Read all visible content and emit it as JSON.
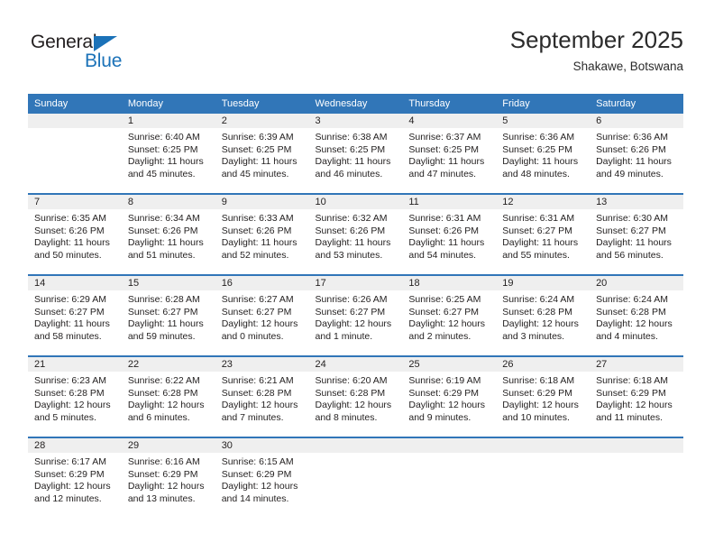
{
  "brand": {
    "name_dark": "General",
    "name_blue": "Blue",
    "accent_color": "#1b72b8"
  },
  "header": {
    "title": "September 2025",
    "subtitle": "Shakawe, Botswana"
  },
  "colors": {
    "header_blue": "#3176b8",
    "daynum_gray": "#efefef",
    "text": "#221f1f"
  },
  "weekday_headers": [
    "Sunday",
    "Monday",
    "Tuesday",
    "Wednesday",
    "Thursday",
    "Friday",
    "Saturday"
  ],
  "weeks": [
    [
      {
        "day": "",
        "sunrise": "",
        "sunset": "",
        "daylight": "",
        "blank": true
      },
      {
        "day": "1",
        "sunrise": "Sunrise: 6:40 AM",
        "sunset": "Sunset: 6:25 PM",
        "daylight": "Daylight: 11 hours and 45 minutes."
      },
      {
        "day": "2",
        "sunrise": "Sunrise: 6:39 AM",
        "sunset": "Sunset: 6:25 PM",
        "daylight": "Daylight: 11 hours and 45 minutes."
      },
      {
        "day": "3",
        "sunrise": "Sunrise: 6:38 AM",
        "sunset": "Sunset: 6:25 PM",
        "daylight": "Daylight: 11 hours and 46 minutes."
      },
      {
        "day": "4",
        "sunrise": "Sunrise: 6:37 AM",
        "sunset": "Sunset: 6:25 PM",
        "daylight": "Daylight: 11 hours and 47 minutes."
      },
      {
        "day": "5",
        "sunrise": "Sunrise: 6:36 AM",
        "sunset": "Sunset: 6:25 PM",
        "daylight": "Daylight: 11 hours and 48 minutes."
      },
      {
        "day": "6",
        "sunrise": "Sunrise: 6:36 AM",
        "sunset": "Sunset: 6:26 PM",
        "daylight": "Daylight: 11 hours and 49 minutes."
      }
    ],
    [
      {
        "day": "7",
        "sunrise": "Sunrise: 6:35 AM",
        "sunset": "Sunset: 6:26 PM",
        "daylight": "Daylight: 11 hours and 50 minutes."
      },
      {
        "day": "8",
        "sunrise": "Sunrise: 6:34 AM",
        "sunset": "Sunset: 6:26 PM",
        "daylight": "Daylight: 11 hours and 51 minutes."
      },
      {
        "day": "9",
        "sunrise": "Sunrise: 6:33 AM",
        "sunset": "Sunset: 6:26 PM",
        "daylight": "Daylight: 11 hours and 52 minutes."
      },
      {
        "day": "10",
        "sunrise": "Sunrise: 6:32 AM",
        "sunset": "Sunset: 6:26 PM",
        "daylight": "Daylight: 11 hours and 53 minutes."
      },
      {
        "day": "11",
        "sunrise": "Sunrise: 6:31 AM",
        "sunset": "Sunset: 6:26 PM",
        "daylight": "Daylight: 11 hours and 54 minutes."
      },
      {
        "day": "12",
        "sunrise": "Sunrise: 6:31 AM",
        "sunset": "Sunset: 6:27 PM",
        "daylight": "Daylight: 11 hours and 55 minutes."
      },
      {
        "day": "13",
        "sunrise": "Sunrise: 6:30 AM",
        "sunset": "Sunset: 6:27 PM",
        "daylight": "Daylight: 11 hours and 56 minutes."
      }
    ],
    [
      {
        "day": "14",
        "sunrise": "Sunrise: 6:29 AM",
        "sunset": "Sunset: 6:27 PM",
        "daylight": "Daylight: 11 hours and 58 minutes."
      },
      {
        "day": "15",
        "sunrise": "Sunrise: 6:28 AM",
        "sunset": "Sunset: 6:27 PM",
        "daylight": "Daylight: 11 hours and 59 minutes."
      },
      {
        "day": "16",
        "sunrise": "Sunrise: 6:27 AM",
        "sunset": "Sunset: 6:27 PM",
        "daylight": "Daylight: 12 hours and 0 minutes."
      },
      {
        "day": "17",
        "sunrise": "Sunrise: 6:26 AM",
        "sunset": "Sunset: 6:27 PM",
        "daylight": "Daylight: 12 hours and 1 minute."
      },
      {
        "day": "18",
        "sunrise": "Sunrise: 6:25 AM",
        "sunset": "Sunset: 6:27 PM",
        "daylight": "Daylight: 12 hours and 2 minutes."
      },
      {
        "day": "19",
        "sunrise": "Sunrise: 6:24 AM",
        "sunset": "Sunset: 6:28 PM",
        "daylight": "Daylight: 12 hours and 3 minutes."
      },
      {
        "day": "20",
        "sunrise": "Sunrise: 6:24 AM",
        "sunset": "Sunset: 6:28 PM",
        "daylight": "Daylight: 12 hours and 4 minutes."
      }
    ],
    [
      {
        "day": "21",
        "sunrise": "Sunrise: 6:23 AM",
        "sunset": "Sunset: 6:28 PM",
        "daylight": "Daylight: 12 hours and 5 minutes."
      },
      {
        "day": "22",
        "sunrise": "Sunrise: 6:22 AM",
        "sunset": "Sunset: 6:28 PM",
        "daylight": "Daylight: 12 hours and 6 minutes."
      },
      {
        "day": "23",
        "sunrise": "Sunrise: 6:21 AM",
        "sunset": "Sunset: 6:28 PM",
        "daylight": "Daylight: 12 hours and 7 minutes."
      },
      {
        "day": "24",
        "sunrise": "Sunrise: 6:20 AM",
        "sunset": "Sunset: 6:28 PM",
        "daylight": "Daylight: 12 hours and 8 minutes."
      },
      {
        "day": "25",
        "sunrise": "Sunrise: 6:19 AM",
        "sunset": "Sunset: 6:29 PM",
        "daylight": "Daylight: 12 hours and 9 minutes."
      },
      {
        "day": "26",
        "sunrise": "Sunrise: 6:18 AM",
        "sunset": "Sunset: 6:29 PM",
        "daylight": "Daylight: 12 hours and 10 minutes."
      },
      {
        "day": "27",
        "sunrise": "Sunrise: 6:18 AM",
        "sunset": "Sunset: 6:29 PM",
        "daylight": "Daylight: 12 hours and 11 minutes."
      }
    ],
    [
      {
        "day": "28",
        "sunrise": "Sunrise: 6:17 AM",
        "sunset": "Sunset: 6:29 PM",
        "daylight": "Daylight: 12 hours and 12 minutes."
      },
      {
        "day": "29",
        "sunrise": "Sunrise: 6:16 AM",
        "sunset": "Sunset: 6:29 PM",
        "daylight": "Daylight: 12 hours and 13 minutes."
      },
      {
        "day": "30",
        "sunrise": "Sunrise: 6:15 AM",
        "sunset": "Sunset: 6:29 PM",
        "daylight": "Daylight: 12 hours and 14 minutes."
      },
      {
        "day": "",
        "sunrise": "",
        "sunset": "",
        "daylight": "",
        "blank": true
      },
      {
        "day": "",
        "sunrise": "",
        "sunset": "",
        "daylight": "",
        "blank": true
      },
      {
        "day": "",
        "sunrise": "",
        "sunset": "",
        "daylight": "",
        "blank": true
      },
      {
        "day": "",
        "sunrise": "",
        "sunset": "",
        "daylight": "",
        "blank": true
      }
    ]
  ]
}
